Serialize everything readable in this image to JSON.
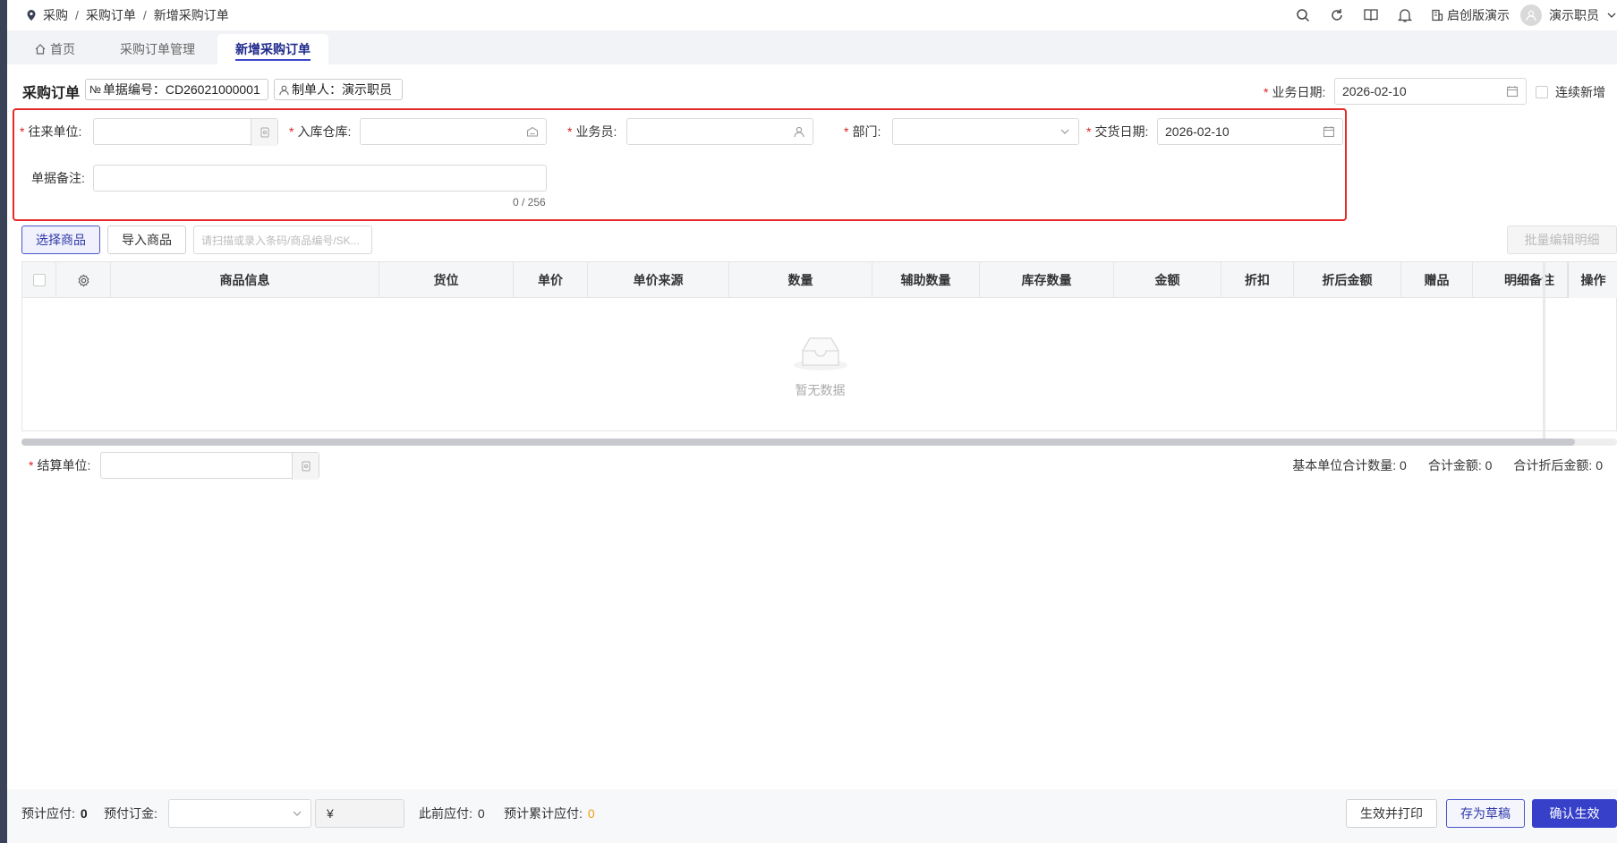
{
  "breadcrumb": {
    "items": [
      "采购",
      "采购订单",
      "新增采购订单"
    ],
    "separator": "/"
  },
  "topbar": {
    "tenant": "启创版演示",
    "user": "演示职员"
  },
  "tabs": [
    {
      "label": "首页"
    },
    {
      "label": "采购订单管理"
    },
    {
      "label": "新增采购订单"
    }
  ],
  "header": {
    "title": "采购订单",
    "doc_no_label": "单据编号：",
    "doc_no_value": "CD26021000001",
    "maker_label": "制单人：",
    "maker_value": "演示职员",
    "biz_date_label": "业务日期:",
    "biz_date_value": "2026-02-10",
    "continuous_label": "连续新增"
  },
  "form": {
    "partner_label": "往来单位:",
    "warehouse_label": "入库仓库:",
    "salesman_label": "业务员:",
    "dept_label": "部门:",
    "delivery_date_label": "交货日期:",
    "delivery_date_value": "2026-02-10",
    "remark_label": "单据备注:",
    "remark_counter": "0 / 256"
  },
  "toolbar": {
    "select_goods": "选择商品",
    "import_goods": "导入商品",
    "scan_placeholder": "请扫描或录入条码/商品编号/SK...",
    "batch_edit": "批量编辑明细"
  },
  "table": {
    "columns": [
      "商品信息",
      "货位",
      "单价",
      "单价来源",
      "数量",
      "辅助数量",
      "库存数量",
      "金额",
      "折扣",
      "折后金额",
      "赠品",
      "明细备注",
      "操作"
    ],
    "empty_text": "暂无数据"
  },
  "settlement": {
    "label": "结算单位:",
    "base_qty_label": "基本单位合计数量:",
    "base_qty_value": "0",
    "total_amount_label": "合计金额:",
    "total_amount_value": "0",
    "total_discounted_label": "合计折后金额:",
    "total_discounted_value": "0"
  },
  "footer": {
    "est_payable_label": "预计应付:",
    "est_payable_value": "0",
    "prepay_label": "预付订金:",
    "currency_symbol": "¥",
    "prev_payable_label": "此前应付:",
    "prev_payable_value": "0",
    "est_cum_payable_label": "预计累计应付:",
    "est_cum_payable_value": "0",
    "btn_print": "生效并打印",
    "btn_draft": "存为草稿",
    "btn_confirm": "确认生效"
  },
  "colors": {
    "accent": "#3640c9",
    "required": "#e02020",
    "highlight_box": "#e52a2a",
    "orange": "#f39c12"
  }
}
